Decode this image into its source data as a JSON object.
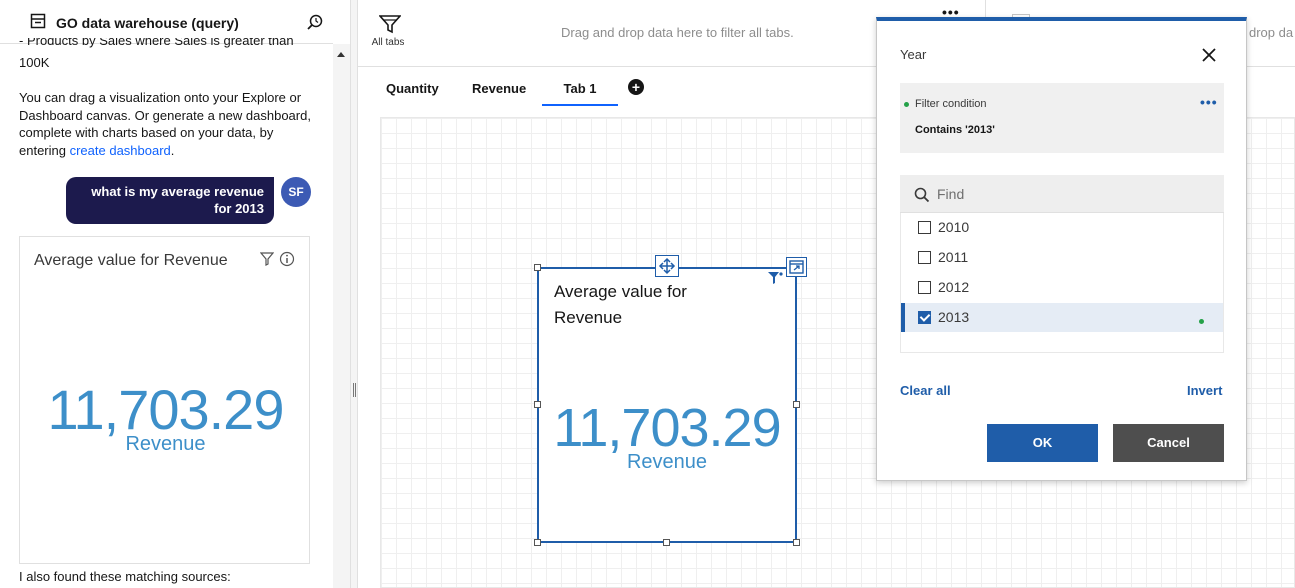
{
  "assistant": {
    "header_title": "GO data warehouse (query)",
    "cut_line": "- Products by Sales where Sales is greater than",
    "cut_line_end": "100K",
    "para_text": "You can drag a visualization onto your Explore or Dashboard canvas. Or generate a new dashboard, complete with charts based on your data, by entering ",
    "para_link": "create dashboard",
    "para_end": ".",
    "user_message": "what is my average revenue for 2013",
    "avatar_initials": "SF",
    "card": {
      "title": "Average value for Revenue",
      "value": "11,703.29",
      "label": "Revenue"
    },
    "footer_text": "I also found these matching sources:"
  },
  "filter_bar": {
    "all_tabs_label": "All tabs",
    "drop_hint": "Drag and drop data here to filter all tabs.",
    "drop_hint_right": "drop da",
    "more": "•••"
  },
  "tabs": [
    {
      "label": "Quantity"
    },
    {
      "label": "Revenue"
    },
    {
      "label": "Tab 1"
    }
  ],
  "widget": {
    "title": "Average value for Revenue",
    "value": "11,703.29",
    "label": "Revenue"
  },
  "popover": {
    "title": "Year",
    "condition_label": "Filter condition",
    "condition_value": "Contains '2013'",
    "more": "•••",
    "find_placeholder": "Find",
    "items": [
      {
        "label": "2010",
        "checked": false
      },
      {
        "label": "2011",
        "checked": false
      },
      {
        "label": "2012",
        "checked": false
      },
      {
        "label": "2013",
        "checked": true
      }
    ],
    "clear_all": "Clear all",
    "invert": "Invert",
    "ok": "OK",
    "cancel": "Cancel"
  },
  "colors": {
    "accent": "#1f5da9",
    "value_blue": "#3d8fc9",
    "bubble": "#1c1a4d",
    "status_green": "#24a148"
  }
}
